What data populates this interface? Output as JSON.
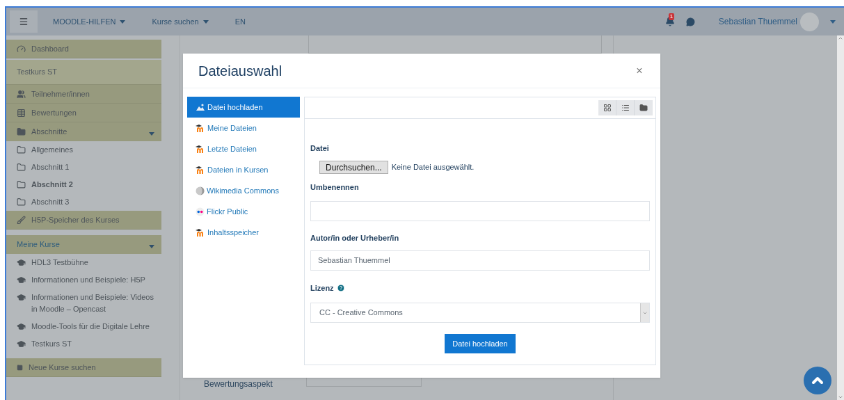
{
  "navbar": {
    "menus": [
      {
        "label": "MOODLE-HILFEN",
        "dropdown": true
      },
      {
        "label": "Kurse suchen",
        "dropdown": true
      },
      {
        "label": "EN",
        "dropdown": false
      }
    ],
    "notification_count": "1",
    "user": "Sebastian Thuemmel"
  },
  "sidebar": {
    "groups": [
      {
        "items": [
          {
            "label": "Dashboard",
            "kind": "nav"
          }
        ]
      },
      {
        "items": [
          {
            "label": "Testkurs ST",
            "kind": "header"
          },
          {
            "label": "Teilnehmer/innen",
            "kind": "nav"
          },
          {
            "label": "Bewertungen",
            "kind": "nav"
          },
          {
            "label": "Abschnitte",
            "kind": "toggle"
          },
          {
            "label": "Allgemeines",
            "kind": "link",
            "selected": false
          },
          {
            "label": "Abschnitt 1",
            "kind": "link",
            "selected": false
          },
          {
            "label": "Abschnitt 2",
            "kind": "link",
            "selected": true
          },
          {
            "label": "Abschnitt 3",
            "kind": "link",
            "selected": false
          },
          {
            "label": "H5P-Speicher des Kurses",
            "kind": "nav"
          }
        ]
      },
      {
        "items": [
          {
            "label": "Meine Kurse",
            "kind": "heading"
          },
          {
            "label": "HDL3 Testbühne",
            "kind": "link",
            "selected": false
          },
          {
            "label": "Informationen und Beispiele: H5P",
            "kind": "link",
            "selected": false
          },
          {
            "label": "Informationen und Beispiele: Videos in Moodle – Opencast",
            "kind": "link",
            "selected": false
          },
          {
            "label": "Moodle-Tools für die Digitale Lehre",
            "kind": "link",
            "selected": false
          },
          {
            "label": "Testkurs ST",
            "kind": "link",
            "selected": false
          }
        ]
      },
      {
        "items": [
          {
            "label": "Neue Kurse suchen",
            "kind": "nav"
          }
        ]
      }
    ]
  },
  "page": {
    "field_label": "Bewertungsaspekt"
  },
  "dialog": {
    "title": "Dateiauswahl",
    "close": "×",
    "repositories": [
      {
        "label": "Datei hochladen",
        "kind": "upload",
        "selected": true
      },
      {
        "label": "Meine Dateien",
        "kind": "moodle",
        "selected": false
      },
      {
        "label": "Letzte Dateien",
        "kind": "moodle",
        "selected": false
      },
      {
        "label": "Dateien in Kursen",
        "kind": "moodle",
        "selected": false
      },
      {
        "label": "Wikimedia Commons",
        "kind": "wikimedia",
        "selected": false
      },
      {
        "label": "Flickr Public",
        "kind": "flickr",
        "selected": false
      },
      {
        "label": "Inhaltsspeicher",
        "kind": "moodle",
        "selected": false
      }
    ],
    "form": {
      "file_label": "Datei",
      "browse_button": "Durchsuchen...",
      "file_status": "Keine Datei ausgewählt.",
      "rename_label": "Umbenennen",
      "author_label": "Autor/in oder Urheber/in",
      "author_value": "Sebastian Thuemmel",
      "license_label": "Lizenz",
      "license_value": "CC - Creative Commons",
      "submit": "Datei hochladen"
    }
  }
}
